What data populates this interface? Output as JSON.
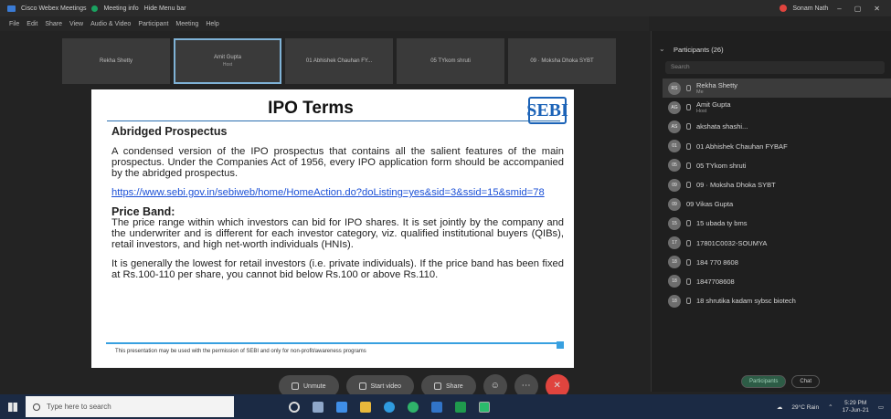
{
  "titlebar": {
    "app_title": "Cisco Webex Meetings",
    "meeting_info": "Meeting info",
    "hide_menu": "Hide Menu bar",
    "user_name": "Sonam Nath",
    "controls": [
      "–",
      "▢",
      "✕"
    ]
  },
  "menubar": {
    "items": [
      "File",
      "Edit",
      "Share",
      "View",
      "Audio & Video",
      "Participant",
      "Meeting",
      "Help"
    ]
  },
  "tiles": [
    {
      "name": "Rekha Shetty",
      "sub": ""
    },
    {
      "name": "Amit Gupta",
      "sub": "Host"
    },
    {
      "name": "01 Abhishek Chauhan FY...",
      "sub": ""
    },
    {
      "name": "05 TYkom shruti",
      "sub": ""
    },
    {
      "name": "09 · Moksha Dhoka SYBT",
      "sub": ""
    }
  ],
  "slide": {
    "title": "IPO Terms",
    "logo_text": "SEBI",
    "heading1": "Abridged Prospectus",
    "para1": "A condensed version of the IPO prospectus that contains all the salient features of the main prospectus. Under the Companies Act of 1956, every IPO application form should be accompanied by the abridged prospectus.",
    "link": "https://www.sebi.gov.in/sebiweb/home/HomeAction.do?doListing=yes&sid=3&ssid=15&smid=78",
    "heading2": "Price Band:",
    "para2": "The price range within which investors can bid for IPO shares. It is set jointly by the company and the underwriter and is different for each investor category, viz. qualified institutional buyers (QIBs), retail investors, and high net-worth individuals (HNIs).",
    "para3": "It is generally the lowest for retail investors (i.e. private individuals). If the price band has been fixed at Rs.100-110 per share, you cannot bid below Rs.100 or above Rs.110.",
    "footer": "This presentation may be used with the permission of SEBI and only for non-profit/awareness programs"
  },
  "panel": {
    "title": "Participants (26)",
    "search_placeholder": "Search",
    "participants": [
      {
        "initials": "RS",
        "name": "Rekha Shetty",
        "role": "Me"
      },
      {
        "initials": "AG",
        "name": "Amit Gupta",
        "role": "Host"
      },
      {
        "initials": "AS",
        "name": "akshata shashi...",
        "role": ""
      },
      {
        "initials": "01",
        "name": "01 Abhishek Chauhan FYBAF",
        "role": ""
      },
      {
        "initials": "05",
        "name": "05 TYkom shruti",
        "role": ""
      },
      {
        "initials": "09",
        "name": "09 · Moksha Dhoka SYBT",
        "role": ""
      },
      {
        "initials": "09",
        "name": "09 Vikas Gupta",
        "role": ""
      },
      {
        "initials": "15",
        "name": "15 ubada ty bms",
        "role": ""
      },
      {
        "initials": "17",
        "name": "17801C0032-SOUMYA",
        "role": ""
      },
      {
        "initials": "18",
        "name": "184 770 8608",
        "role": ""
      },
      {
        "initials": "18",
        "name": "1847708608",
        "role": ""
      },
      {
        "initials": "18",
        "name": "18 shrutika kadam sybsc biotech",
        "role": ""
      }
    ],
    "participants_button": "Participants",
    "chat_button": "Chat"
  },
  "controls": {
    "unmute": "Unmute",
    "start_video": "Start video",
    "share": "Share"
  },
  "taskbar": {
    "search_placeholder": "Type here to search",
    "weather": "29°C Rain",
    "time": "5:29 PM",
    "date": "17-Jun-21"
  },
  "colors": {
    "link": "#1a4fd6",
    "sebi_blue": "#1c63b7",
    "end_call": "#e0443e",
    "taskbar": "#1b2a44"
  }
}
